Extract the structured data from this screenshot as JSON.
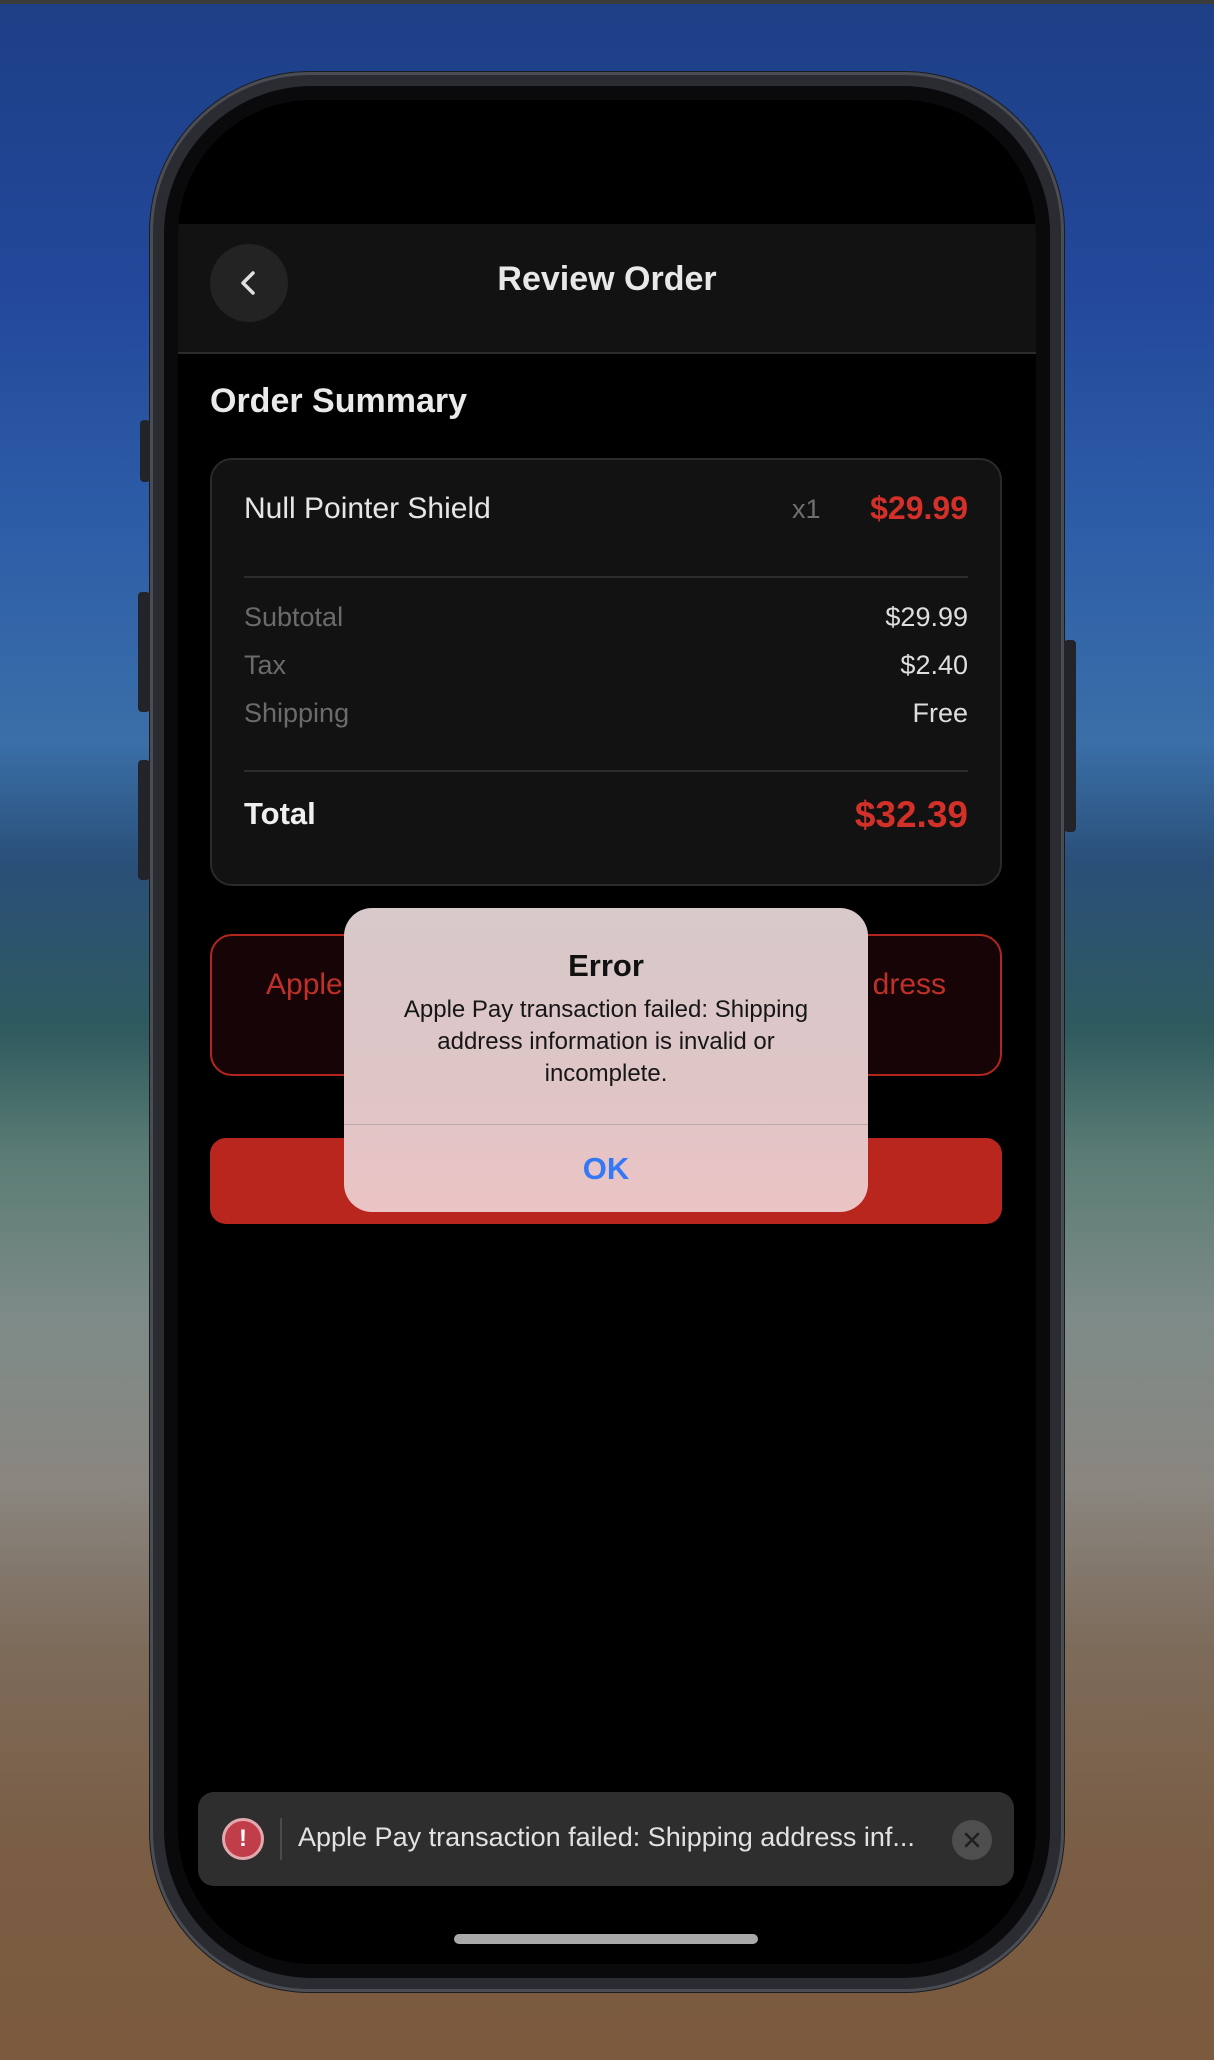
{
  "header": {
    "title": "Review Order",
    "back_icon": "chevron-left-icon"
  },
  "order_summary": {
    "heading": "Order Summary",
    "item": {
      "name": "Null Pointer Shield",
      "quantity": "x1",
      "price": "$29.99"
    },
    "rows": [
      {
        "label": "Subtotal",
        "value": "$29.99"
      },
      {
        "label": "Tax",
        "value": "$2.40"
      },
      {
        "label": "Shipping",
        "value": "Free"
      }
    ],
    "total": {
      "label": "Total",
      "value": "$32.39"
    }
  },
  "apple_pay_box": {
    "visible_left": "Apple",
    "visible_right": "dress"
  },
  "alert": {
    "title": "Error",
    "message": "Apple Pay transaction failed: Shipping address information is invalid or incomplete.",
    "ok_label": "OK"
  },
  "toast": {
    "icon": "error-exclamation-icon",
    "text": "Apple Pay transaction failed: Shipping address inf...",
    "close_icon": "close-icon"
  },
  "colors": {
    "accent_red": "#d4302a",
    "button_red": "#b9261d",
    "link_blue": "#3478f6",
    "screen_bg": "#000000"
  }
}
